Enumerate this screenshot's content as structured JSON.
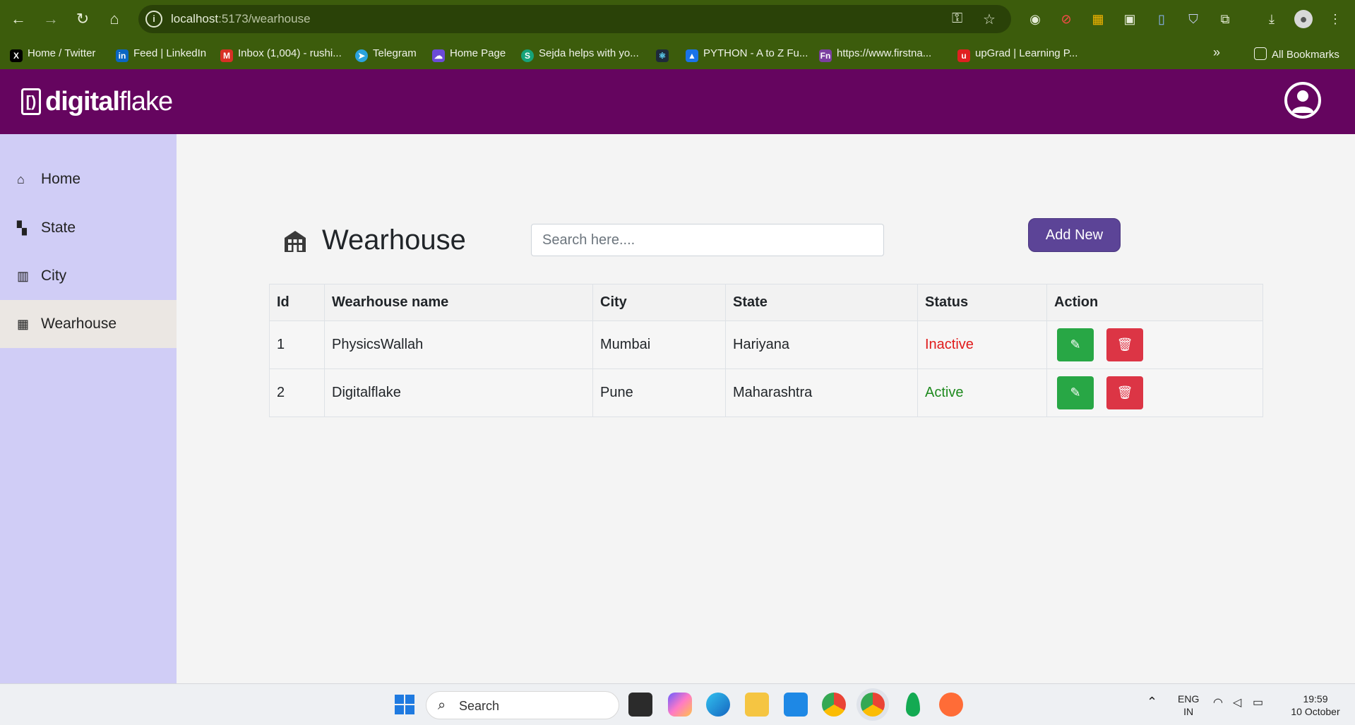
{
  "browser": {
    "url_host": "localhost",
    "url_path": ":5173/wearhouse",
    "bookmarks": [
      {
        "label": "Home / Twitter",
        "color": "#000000",
        "glyph": "X"
      },
      {
        "label": "Feed | LinkedIn",
        "color": "#0a66c2",
        "glyph": "in"
      },
      {
        "label": "Inbox (1,004) - rushi...",
        "color": "#d93025",
        "glyph": "M"
      },
      {
        "label": "Telegram",
        "color": "#2aa3df",
        "glyph": "➤"
      },
      {
        "label": "Home Page",
        "color": "#6b4bd8",
        "glyph": "☁"
      },
      {
        "label": "Sejda helps with yo...",
        "color": "#16a37a",
        "glyph": "S"
      },
      {
        "label": "PYTHON - A to Z Fu...",
        "color": "#1a73e8",
        "glyph": "▲"
      },
      {
        "label": "https://www.firstna...",
        "color": "#7b3fa0",
        "glyph": "Fn"
      },
      {
        "label": "upGrad | Learning P...",
        "color": "#e02020",
        "glyph": "u"
      }
    ],
    "all_bookmarks_label": "All Bookmarks"
  },
  "header": {
    "logo_bold": "digital",
    "logo_light": "flake",
    "logo_box": "[)"
  },
  "sidebar": {
    "items": [
      {
        "label": "Home",
        "icon": "home-icon"
      },
      {
        "label": "State",
        "icon": "map-icon"
      },
      {
        "label": "City",
        "icon": "city-icon"
      },
      {
        "label": "Wearhouse",
        "icon": "warehouse-icon",
        "active": true
      }
    ]
  },
  "main": {
    "title": "Wearhouse",
    "search_placeholder": "Search here....",
    "add_button": "Add New",
    "table": {
      "headers": [
        "Id",
        "Wearhouse name",
        "City",
        "State",
        "Status",
        "Action"
      ],
      "rows": [
        {
          "id": "1",
          "name": "PhysicsWallah",
          "city": "Mumbai",
          "state": "Hariyana",
          "status": "Inactive"
        },
        {
          "id": "2",
          "name": "Digitalflake",
          "city": "Pune",
          "state": "Maharashtra",
          "status": "Active"
        }
      ]
    }
  },
  "taskbar": {
    "search_label": "Search",
    "lang_top": "ENG",
    "lang_bottom": "IN",
    "time": "19:59",
    "date": "10 October"
  },
  "colors": {
    "chrome": "#3c5c0c",
    "header": "#65055f",
    "sidebar": "#d0cdf6",
    "add_button": "#5c4497",
    "edit": "#28a745",
    "delete": "#dc3545",
    "inactive": "#e01b1b",
    "active": "#1f8a1f"
  }
}
